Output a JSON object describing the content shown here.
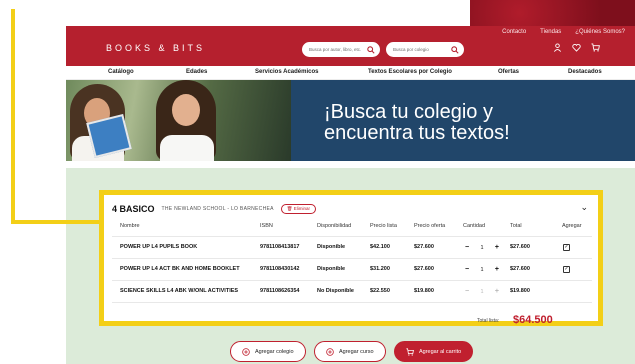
{
  "colors": {
    "brand_red": "#b5202e",
    "highlight_yellow": "#f3cf17",
    "banner_blue": "#21466a",
    "total_red": "#c0202f"
  },
  "top_links": [
    "Contacto",
    "Tiendas",
    "¿Quiénes Somos?"
  ],
  "header": {
    "logo": "BOOKS & BITS",
    "search_title_placeholder": "Busca por autor, libro, etc.",
    "search_school_placeholder": "Busca por colegio",
    "icons": [
      "user-icon",
      "heart-icon",
      "cart-icon"
    ]
  },
  "categories": [
    "Catálogo",
    "Edades",
    "Servicios Académicos",
    "Textos Escolares por Colegio",
    "Ofertas",
    "Destacados"
  ],
  "banner": {
    "headline_line1": "¡Busca tu colegio y",
    "headline_line2": "encuentra tus textos!"
  },
  "order": {
    "grade": "4 BASICO",
    "school": "THE NEWLAND SCHOOL - LO BARNECHEA",
    "remove_label": "Eliminar",
    "columns": [
      "Nombre",
      "ISBN",
      "Disponibilidad",
      "Precio lista",
      "Precio oferta",
      "Cantidad",
      "Total",
      "Agregar"
    ],
    "rows": [
      {
        "name": "POWER UP L4 PUPILS BOOK",
        "isbn": "9781108413817",
        "availability": "Disponible",
        "list_price": "$42.100",
        "offer_price": "$27.600",
        "qty": "1",
        "total": "$27.600",
        "checked": true
      },
      {
        "name": "POWER UP L4 ACT BK AND HOME BOOKLET",
        "isbn": "9781108430142",
        "availability": "Disponible",
        "list_price": "$31.200",
        "offer_price": "$27.600",
        "qty": "1",
        "total": "$27.600",
        "checked": true
      },
      {
        "name": "SCIENCE SKILLS L4 ABK W/ONL ACTIVITIES",
        "isbn": "9781108626354",
        "availability": "No Disponible",
        "list_price": "$22.550",
        "offer_price": "$19.800",
        "qty": "1",
        "total": "$19.800",
        "checked": false
      }
    ],
    "total_label": "Total lista:",
    "total_value": "$64.500"
  },
  "actions": {
    "add_school": "Agregar colegio",
    "add_course": "Agregar curso",
    "add_to_cart": "Agregar al carrito"
  }
}
